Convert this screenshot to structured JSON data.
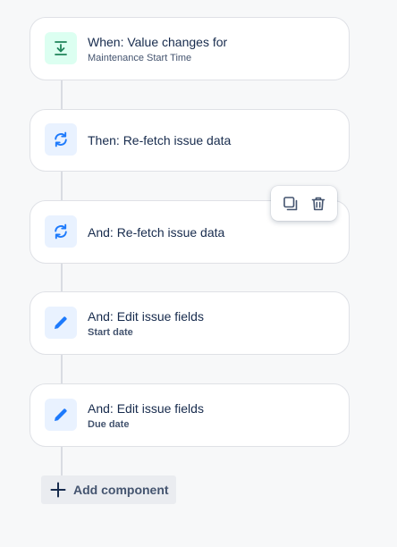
{
  "rule": {
    "components": [
      {
        "title": "When: Value changes for",
        "subtitle": "Maintenance Start Time",
        "icon": "field-value-changed-icon"
      },
      {
        "title": "Then: Re-fetch issue data",
        "subtitle": "",
        "icon": "refresh-icon"
      },
      {
        "title": "And: Re-fetch issue data",
        "subtitle": "",
        "icon": "refresh-icon"
      },
      {
        "title": "And: Edit issue fields",
        "subtitle": "Start date",
        "icon": "pencil-icon"
      },
      {
        "title": "And: Edit issue fields",
        "subtitle": "Due date",
        "icon": "pencil-icon"
      }
    ],
    "hover_actions": {
      "duplicate": "duplicate-icon",
      "delete": "trash-icon"
    },
    "add_component_label": "Add component"
  },
  "colors": {
    "background": "#f7f8f9",
    "trigger_accent": "#1f845a",
    "action_accent": "#1d7afc",
    "text": "#172b4d"
  }
}
